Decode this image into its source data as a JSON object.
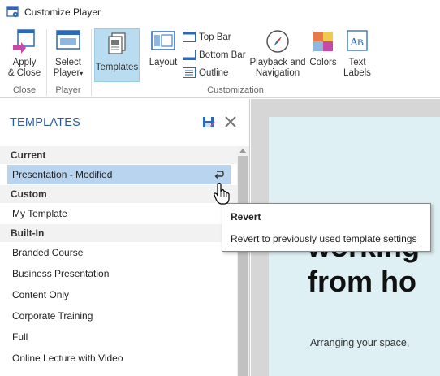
{
  "window": {
    "title": "Customize Player"
  },
  "ribbon": {
    "apply_close_label": "Apply\n& Close",
    "select_player_label": "Select\nPlayer",
    "templates_label": "Templates",
    "layout_label": "Layout",
    "top_bar_label": "Top Bar",
    "bottom_bar_label": "Bottom Bar",
    "outline_label": "Outline",
    "playback_nav_label": "Playback and\nNavigation",
    "colors_label": "Colors",
    "text_labels_label": "Text\nLabels",
    "groups": {
      "close": "Close",
      "player": "Player",
      "customization": "Customization"
    }
  },
  "panel": {
    "title": "TEMPLATES",
    "sections": {
      "current": "Current",
      "custom": "Custom",
      "builtin": "Built-In"
    },
    "current_item": "Presentation - Modified",
    "custom_items": [
      "My Template"
    ],
    "builtin_items": [
      "Branded Course",
      "Business Presentation",
      "Content Only",
      "Corporate Training",
      "Full",
      "Online Lecture with Video"
    ]
  },
  "tooltip": {
    "title": "Revert",
    "body": "Revert to previously used template settings"
  },
  "preview": {
    "heading_line1": "working",
    "heading_line2": "from ho",
    "subtitle": "Arranging your space,"
  },
  "colors": {
    "accent": "#2c5aa0",
    "selection": "#b9d4ee",
    "active_button": "#b9dcf0"
  }
}
